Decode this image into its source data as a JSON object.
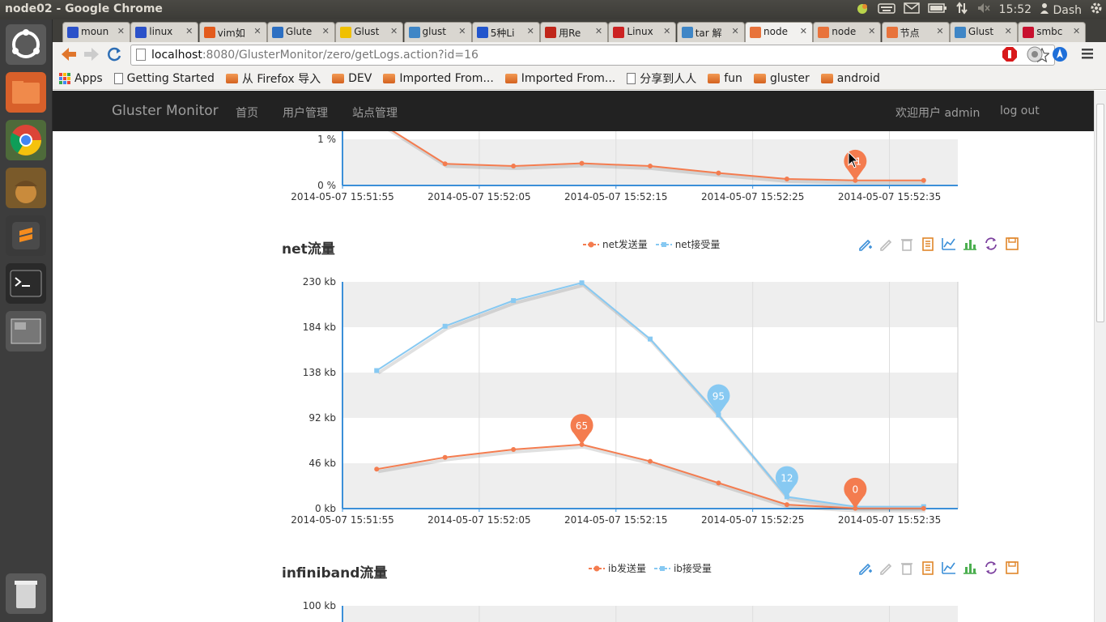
{
  "window": {
    "title": "node02 - Google Chrome"
  },
  "system": {
    "time": "15:52",
    "dash_label": "Dash"
  },
  "tabs": [
    {
      "label": "moun",
      "color": "#2b51c9"
    },
    {
      "label": "linux",
      "color": "#2b51c9"
    },
    {
      "label": "vim如",
      "color": "#e35b1d"
    },
    {
      "label": "Glute",
      "color": "#2c6fc2"
    },
    {
      "label": "Glust",
      "color": "#f0c000"
    },
    {
      "label": "glust",
      "color": "#3f86c6"
    },
    {
      "label": "5种Li",
      "color": "#2255cc"
    },
    {
      "label": "用Re",
      "color": "#c0261a"
    },
    {
      "label": "Linux",
      "color": "#cc2222"
    },
    {
      "label": "tar 解",
      "color": "#3f86c6"
    },
    {
      "label": "node",
      "color": "#e8733b"
    },
    {
      "label": "node",
      "color": "#e8733b"
    },
    {
      "label": "节点",
      "color": "#e8733b"
    },
    {
      "label": "Glust",
      "color": "#3f86c6"
    },
    {
      "label": "smbc",
      "color": "#c8102e"
    }
  ],
  "url": {
    "host": "localhost",
    "rest": ":8080/GlusterMonitor/zero/getLogs.action?id=16"
  },
  "bookmarks": [
    {
      "label": "Apps",
      "kind": "apps"
    },
    {
      "label": "Getting Started",
      "kind": "page"
    },
    {
      "label": "从 Firefox 导入",
      "kind": "folder"
    },
    {
      "label": "DEV",
      "kind": "folder"
    },
    {
      "label": "Imported From...",
      "kind": "folder"
    },
    {
      "label": "Imported From...",
      "kind": "folder"
    },
    {
      "label": "分享到人人",
      "kind": "page"
    },
    {
      "label": "fun",
      "kind": "folder"
    },
    {
      "label": "gluster",
      "kind": "folder"
    },
    {
      "label": "android",
      "kind": "folder"
    }
  ],
  "navbar": {
    "brand": "Gluster Monitor",
    "home": "首页",
    "users": "用户管理",
    "sites": "站点管理",
    "welcome": "欢迎用户 admin",
    "logout": "log out"
  },
  "colors": {
    "send": "#f47c4f",
    "recv": "#87c9f2",
    "navbar": "#222222"
  },
  "chart_data": [
    {
      "type": "line",
      "title": "",
      "x": [
        "2014-05-07 15:51:55",
        "2014-05-07 15:52:05",
        "2014-05-07 15:52:15",
        "2014-05-07 15:52:25",
        "2014-05-07 15:52:35"
      ],
      "y_ticks": [
        "0 %",
        "1 %"
      ],
      "series": [
        {
          "name": "",
          "points": [
            [
              0.5,
              1.4
            ],
            [
              1.5,
              0.47
            ],
            [
              2.5,
              0.42
            ],
            [
              3.5,
              0.48
            ],
            [
              4.5,
              0.42
            ],
            [
              5.5,
              0.27
            ],
            [
              6.5,
              0.14
            ],
            [
              7.5,
              0.11
            ],
            [
              8.5,
              0.11
            ]
          ]
        }
      ],
      "markers": [
        {
          "x": 7.5,
          "y": 0.11,
          "label": "11"
        }
      ]
    },
    {
      "type": "line",
      "title": "net流量",
      "x": [
        "2014-05-07 15:51:55",
        "2014-05-07 15:52:05",
        "2014-05-07 15:52:15",
        "2014-05-07 15:52:25",
        "2014-05-07 15:52:35"
      ],
      "y_ticks": [
        "0 kb",
        "46 kb",
        "92 kb",
        "138 kb",
        "184 kb",
        "230 kb"
      ],
      "ylim": [
        0,
        230
      ],
      "series": [
        {
          "name": "net发送量",
          "values": [
            40,
            52,
            60,
            65,
            48,
            26,
            4,
            0.3,
            0.2
          ]
        },
        {
          "name": "net接受量",
          "values": [
            140,
            185,
            211,
            229,
            172,
            95,
            12,
            2,
            2
          ]
        }
      ],
      "markers": [
        {
          "series": 0,
          "index": 3,
          "label": "65"
        },
        {
          "series": 1,
          "index": 5,
          "label": "95"
        },
        {
          "series": 1,
          "index": 6,
          "label": "12"
        },
        {
          "series": 0,
          "index": 7,
          "label": "0"
        }
      ]
    },
    {
      "type": "line",
      "title": "infiniband流量",
      "y_ticks": [
        "100 kb"
      ],
      "series": [
        {
          "name": "ib发送量",
          "values": []
        },
        {
          "name": "ib接受量",
          "values": []
        }
      ]
    }
  ]
}
